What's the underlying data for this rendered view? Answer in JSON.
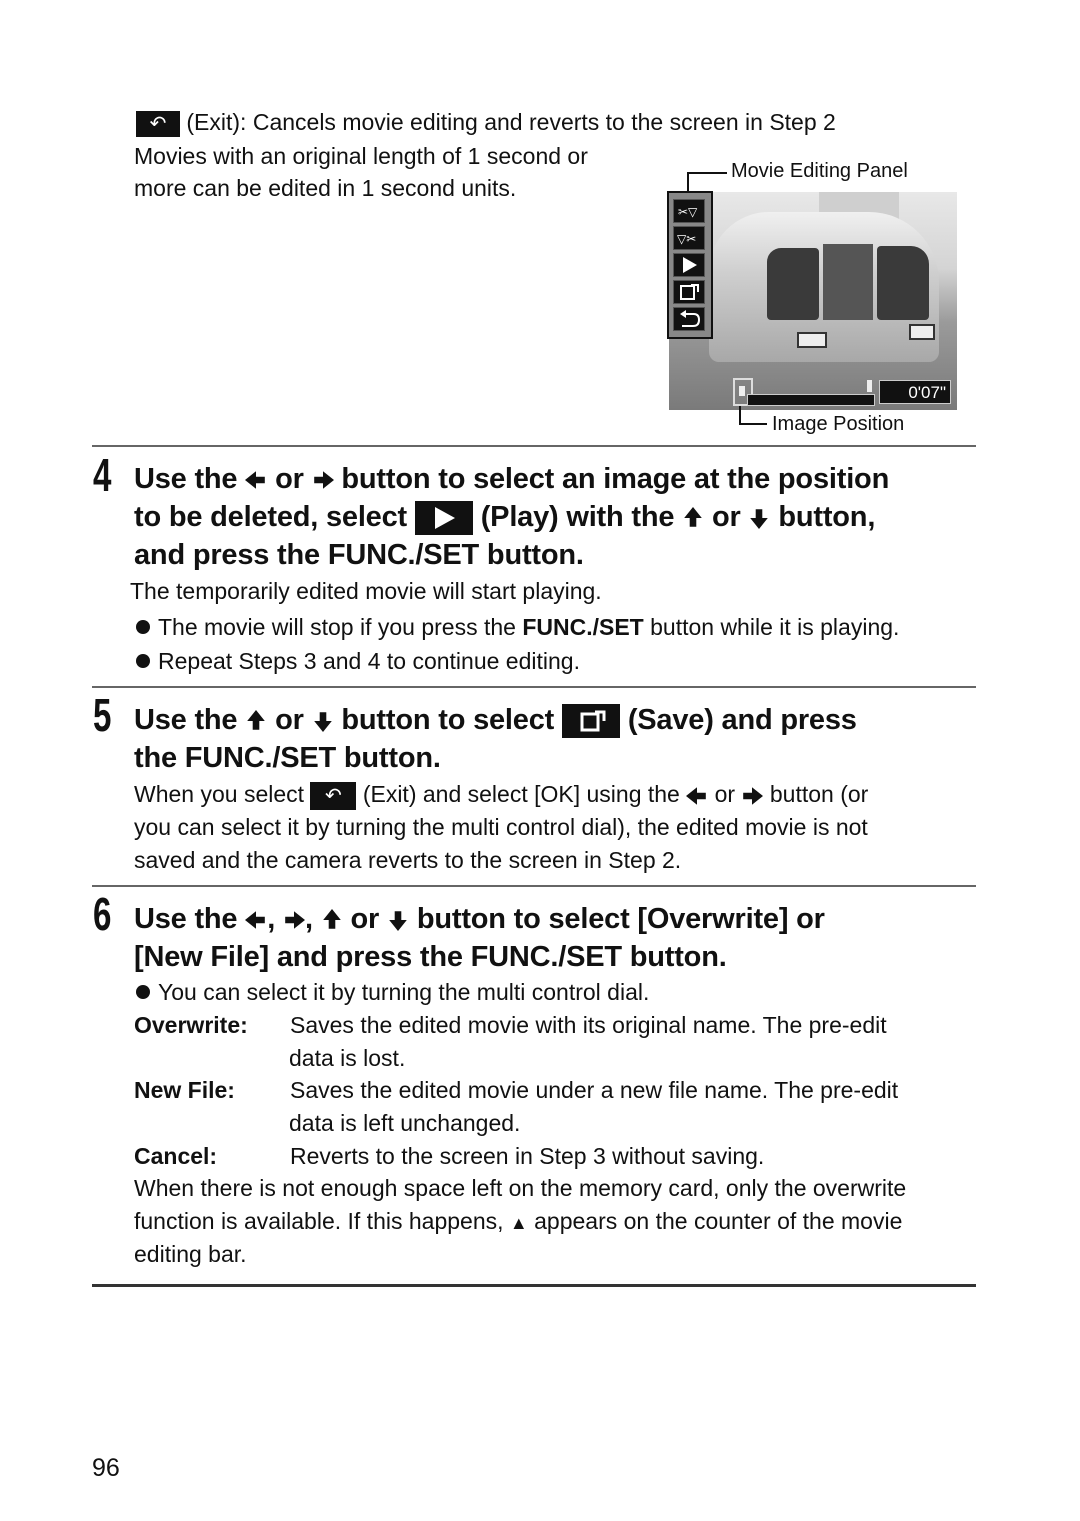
{
  "intro": {
    "exit_icon": "exit-return-icon",
    "exit_line": "(Exit): Cancels movie editing and reverts to the screen in Step 2",
    "note_line1": "Movies with an original length of 1 second or",
    "note_line2": "more can be edited in 1 second units."
  },
  "figure": {
    "label_panel": "Movie Editing Panel",
    "label_position": "Image Position",
    "panel_buttons": [
      "cut-front-icon",
      "cut-back-icon",
      "play-icon",
      "save-icon",
      "exit-icon"
    ],
    "counter": "0'07\""
  },
  "step4": {
    "number": "4",
    "h1_a": "Use the",
    "h1_or": "or",
    "h1_b": "button to select an image at the position",
    "h2_a": "to be deleted, select",
    "h2_b": "(Play) with the",
    "h2_or": "or",
    "h2_c": "button,",
    "h3": "and press the FUNC./SET button.",
    "desc": "The temporarily edited movie will start playing.",
    "bullet1_a": "The movie will stop if you press the",
    "bullet1_bold": "FUNC./SET",
    "bullet1_b": "button while it is playing.",
    "bullet2": "Repeat Steps 3 and 4 to continue editing."
  },
  "step5": {
    "number": "5",
    "h1_a": "Use the",
    "h1_or": "or",
    "h1_b": "button to select",
    "h1_c": "(Save) and press",
    "h2": "the FUNC./SET button.",
    "p1_a": "When you select",
    "p1_b": "(Exit) and select [OK] using the",
    "p1_or": "or",
    "p1_c": "button (or",
    "p2": "you can select it by turning the multi control dial), the edited movie is not",
    "p3": "saved and the camera reverts to the screen in Step 2."
  },
  "step6": {
    "number": "6",
    "h1_a": "Use the",
    "comma": ",",
    "h1_or": "or",
    "h1_b": "button to select [Overwrite] or",
    "h2": "[New File] and press the FUNC./SET button.",
    "bullet1": "You can select it by turning the multi control dial.",
    "defs": [
      {
        "term": "Overwrite:",
        "line1": "Saves the edited movie with its original name. The pre-edit",
        "line2": "data is lost."
      },
      {
        "term": "New File:",
        "line1": "Saves the edited movie under a new file name. The pre-edit",
        "line2": "data is left unchanged."
      },
      {
        "term": "Cancel:",
        "line1": "Reverts to the screen in Step 3 without saving.",
        "line2": ""
      }
    ],
    "note1": "When there is not enough space left on the memory card, only the overwrite",
    "note2_a": "function is available. If this happens,",
    "note2_warn": "▲",
    "note2_b": "appears on the counter of the movie",
    "note3": "editing bar."
  },
  "footer": {
    "page_number": "96"
  }
}
